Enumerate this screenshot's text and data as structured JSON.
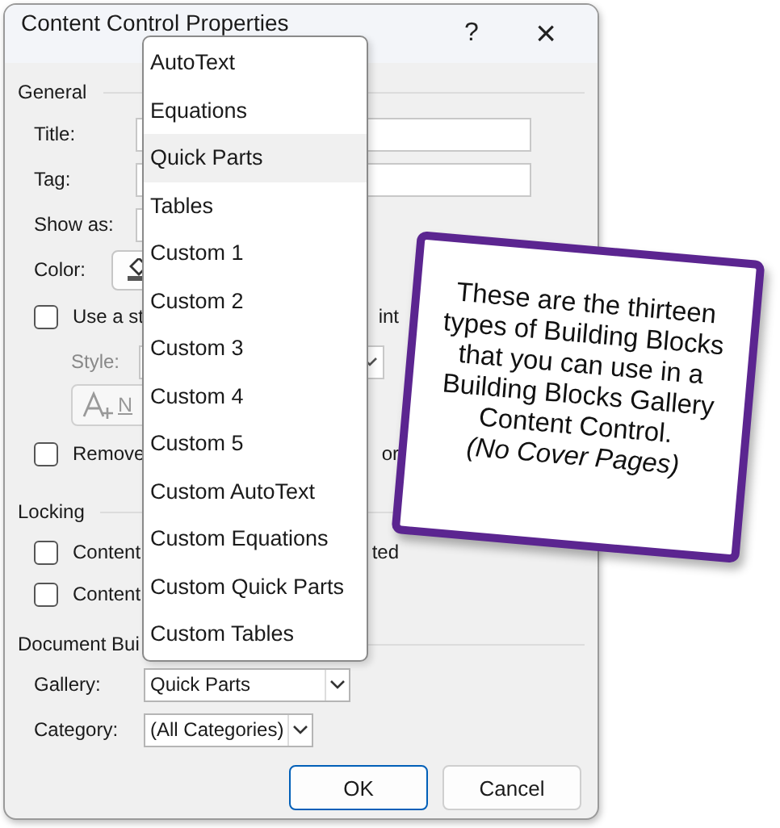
{
  "window": {
    "title": "Content Control Properties",
    "help": "?",
    "close": "×"
  },
  "general": {
    "heading": "General",
    "title_label": "Title:",
    "tag_label": "Tag:",
    "show_as_label": "Show as:",
    "color_label": "Color:",
    "style_checkbox": {
      "label": "Use a st",
      "label_end": "int",
      "checked": false
    },
    "style_label": "Style:",
    "new_style_button": "N",
    "remove_checkbox": {
      "label": "Remove",
      "label_end": "or",
      "checked": false
    }
  },
  "locking": {
    "heading": "Locking",
    "checkboxes": [
      {
        "label": "Content",
        "label_end": "ted",
        "checked": false
      },
      {
        "label": "Content",
        "checked": false
      }
    ]
  },
  "building_blocks": {
    "heading": "Document Bui",
    "gallery_label": "Gallery:",
    "gallery_value": "Quick Parts",
    "category_label": "Category:",
    "category_value": "(All Categories)"
  },
  "dropdown": {
    "items": [
      {
        "label": "AutoText",
        "selected": false
      },
      {
        "label": "Equations",
        "selected": false
      },
      {
        "label": "Quick Parts",
        "selected": true
      },
      {
        "label": "Tables",
        "selected": false
      },
      {
        "label": "Custom 1",
        "selected": false
      },
      {
        "label": "Custom 2",
        "selected": false
      },
      {
        "label": "Custom 3",
        "selected": false
      },
      {
        "label": "Custom 4",
        "selected": false
      },
      {
        "label": "Custom 5",
        "selected": false
      },
      {
        "label": "Custom AutoText",
        "selected": false
      },
      {
        "label": "Custom Equations",
        "selected": false
      },
      {
        "label": "Custom Quick Parts",
        "selected": false
      },
      {
        "label": "Custom Tables",
        "selected": false
      }
    ]
  },
  "buttons": [
    "OK",
    "Cancel"
  ],
  "callout": {
    "text": "These are the thirteen types of Building Blocks that you can use in a Building Blocks Gallery Content Control.",
    "note": "(No Cover Pages)"
  }
}
